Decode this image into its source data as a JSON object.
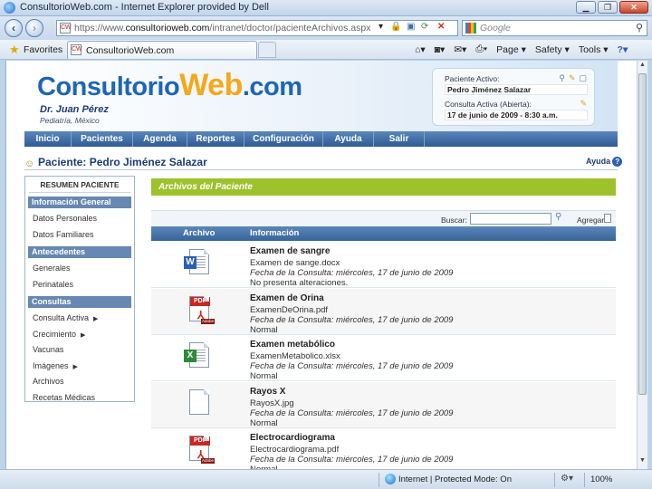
{
  "window": {
    "title": "ConsultorioWeb.com - Internet Explorer provided by Dell",
    "minimize_glyph": "▁",
    "maximize_glyph": "❐",
    "close_glyph": "✕"
  },
  "browser": {
    "url_prefix": "https://www.",
    "url_domain": "consultorioweb.com",
    "url_path": "/intranet/doctor/pacienteArchivos.aspx",
    "search_placeholder": "Google",
    "favorites_label": "Favorites",
    "tab_label": "ConsultorioWeb.com",
    "favicon_text": "CW",
    "command_page": "Page ▾",
    "command_safety": "Safety ▾",
    "command_tools": "Tools ▾",
    "command_help": "?▾"
  },
  "site": {
    "logo_part1": "Consultorio",
    "logo_part2": "Web",
    "logo_part3": ".com",
    "doctor_name": "Dr. Juan Pérez",
    "doctor_specialty": "Pediatría, México",
    "active_patient_label": "Paciente Activo:",
    "active_patient_value": "Pedro Jiménez Salazar",
    "active_consult_label": "Consulta Activa (Abierta):",
    "active_consult_value": "17 de junio de 2009 - 8:30 a.m."
  },
  "nav": [
    {
      "label": "Inicio",
      "width": 52
    },
    {
      "label": "Pacientes",
      "width": 68
    },
    {
      "label": "Agenda",
      "width": 60
    },
    {
      "label": "Reportes",
      "width": 63
    },
    {
      "label": "Configuración",
      "width": 87
    },
    {
      "label": "Ayuda",
      "width": 56
    },
    {
      "label": "Salir",
      "width": 56
    }
  ],
  "page": {
    "title": "Paciente: Pedro Jiménez Salazar",
    "help_label": "Ayuda",
    "help_glyph": "?"
  },
  "sidebar": {
    "heading": "RESUMEN PACIENTE",
    "sections": [
      {
        "label": "Información General",
        "items": [
          "Datos Personales",
          "Datos Familiares"
        ]
      },
      {
        "label": "Antecedentes",
        "items": [
          "Generales",
          "Perinatales"
        ]
      },
      {
        "label": "Consultas",
        "items": [
          "Consulta Activa",
          "Crecimiento",
          "Vacunas",
          "Imágenes",
          "Archivos",
          "Recetas Médicas"
        ]
      }
    ],
    "submenu_glyph": "▶"
  },
  "files_panel": {
    "heading": "Archivos del Paciente",
    "search_label": "Buscar:",
    "search_value": "",
    "add_label": "Agregar",
    "col_file": "Archivo",
    "col_info": "Información",
    "rows": [
      {
        "type": "word",
        "title": "Examen de sangre",
        "file": "Examen de sange.docx",
        "date": "Fecha de la Consulta: miércoles, 17 de junio de 2009",
        "note": "No presenta alteraciones."
      },
      {
        "type": "pdf",
        "title": "Examen de Orina",
        "file": "ExamenDeOrina.pdf",
        "date": "Fecha de la Consulta: miércoles, 17 de junio de 2009",
        "note": "Normal"
      },
      {
        "type": "excel",
        "title": "Examen metabólico",
        "file": "ExamenMetabolico.xlsx",
        "date": "Fecha de la Consulta: miércoles, 17 de junio de 2009",
        "note": "Normal"
      },
      {
        "type": "image",
        "title": "Rayos X",
        "file": "RayosX.jpg",
        "date": "Fecha de la Consulta: miércoles, 17 de junio de 2009",
        "note": "Normal"
      },
      {
        "type": "pdf",
        "title": "Electrocardiograma",
        "file": "Electrocardiograma.pdf",
        "date": "Fecha de la Consulta: miércoles, 17 de junio de 2009",
        "note": "Normal"
      }
    ],
    "pdf_badge": "PDF",
    "adobe_badge": "Adobe",
    "word_badge": "W",
    "excel_badge": "X"
  },
  "statusbar": {
    "zone": "Internet | Protected Mode: On",
    "zoom": "100%"
  }
}
